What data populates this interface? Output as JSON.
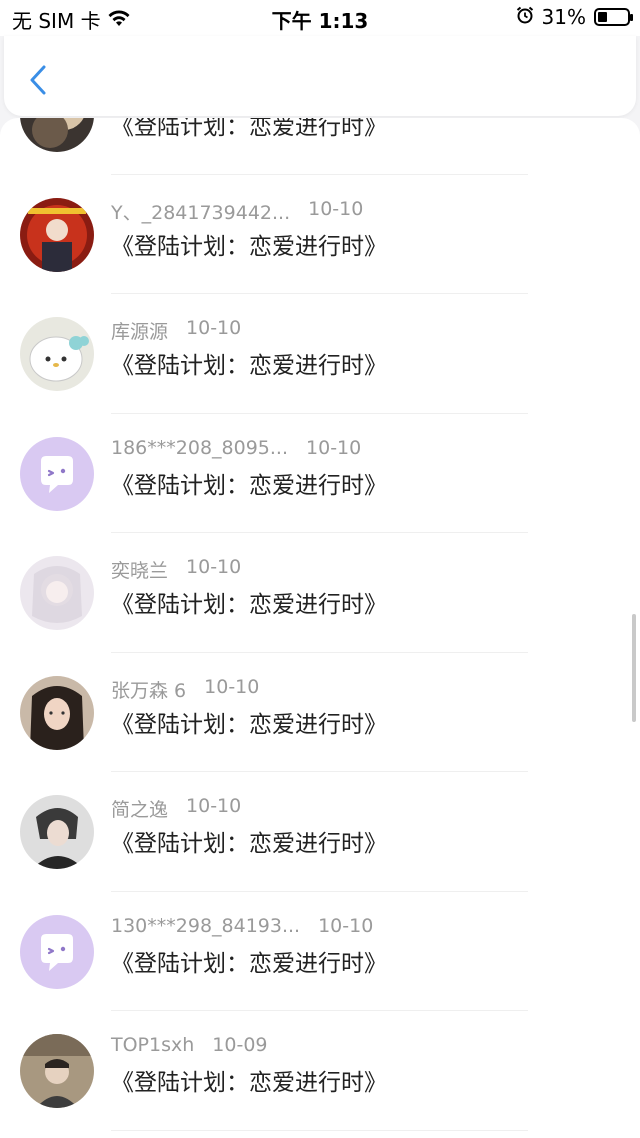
{
  "status_bar": {
    "carrier": "无 SIM 卡",
    "time": "下午 1:13",
    "battery": "31%",
    "battery_level": 0.31
  },
  "nav": {
    "back_icon": "chevron-left-icon"
  },
  "colors": {
    "accent": "#3a8ee6",
    "muted": "#9a9a9a",
    "placeholder_avatar": "#d9c9f2"
  },
  "items": [
    {
      "name": "",
      "date": "",
      "message": "《登陆计划：恋爱进行时》",
      "avatar": "photo"
    },
    {
      "name": "Y、_2841739442...",
      "date": "10-10",
      "message": "《登陆计划：恋爱进行时》",
      "avatar": "photo"
    },
    {
      "name": "库源源",
      "date": "10-10",
      "message": "《登陆计划：恋爱进行时》",
      "avatar": "photo"
    },
    {
      "name": "186***208_8095...",
      "date": "10-10",
      "message": "《登陆计划：恋爱进行时》",
      "avatar": "default"
    },
    {
      "name": "奕晓兰",
      "date": "10-10",
      "message": "《登陆计划：恋爱进行时》",
      "avatar": "photo"
    },
    {
      "name": "张万森 6",
      "date": "10-10",
      "message": "《登陆计划：恋爱进行时》",
      "avatar": "photo"
    },
    {
      "name": "简之逸",
      "date": "10-10",
      "message": "《登陆计划：恋爱进行时》",
      "avatar": "photo"
    },
    {
      "name": "130***298_84193...",
      "date": "10-10",
      "message": "《登陆计划：恋爱进行时》",
      "avatar": "default"
    },
    {
      "name": "TOP1sxh",
      "date": "10-09",
      "message": "《登陆计划：恋爱进行时》",
      "avatar": "photo"
    }
  ]
}
